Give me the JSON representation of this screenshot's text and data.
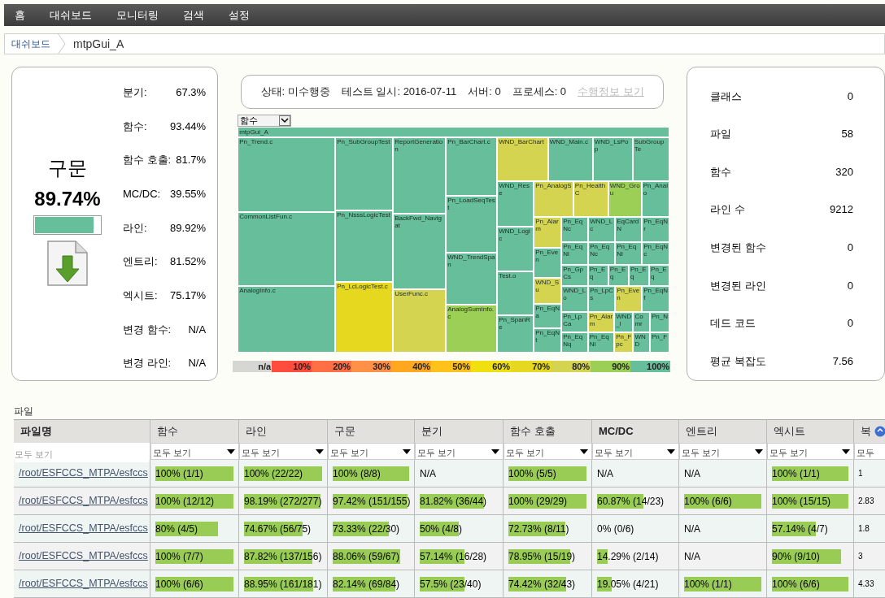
{
  "nav": [
    {
      "label": "홈"
    },
    {
      "label": "대쉬보드"
    },
    {
      "label": "모니터링"
    },
    {
      "label": "검색"
    },
    {
      "label": "설정"
    }
  ],
  "breadcrumb": [
    {
      "label": "대쉬보드"
    },
    {
      "label": "mtpGui_A"
    }
  ],
  "summary": {
    "title": "구문",
    "value": "89.74%",
    "level": 0.8974,
    "stats": [
      {
        "label": "분기:",
        "value": "67.3%"
      },
      {
        "label": "함수:",
        "value": "93.44%"
      },
      {
        "label": "함수 호출:",
        "value": "81.7%"
      },
      {
        "label": "MC/DC:",
        "value": "39.55%"
      },
      {
        "label": "라인:",
        "value": "89.92%"
      },
      {
        "label": "엔트리:",
        "value": "81.52%"
      },
      {
        "label": "엑시트:",
        "value": "75.17%"
      },
      {
        "label": "변경 함수:",
        "value": "N/A"
      },
      {
        "label": "변경 라인:",
        "value": "N/A"
      }
    ]
  },
  "status": {
    "items": [
      "상태: 미수행중",
      "테스트 일시: 2016-07-11",
      "서버: 0",
      "프로세스: 0"
    ],
    "link": "수행정보 보기"
  },
  "treemap": {
    "metric": "함수",
    "root": "mtpGui_A",
    "cells": [
      {
        "label": "Pn_Trend.c",
        "color": "#66bf9a"
      },
      {
        "label": "CommonListFun.c",
        "color": "#66bf9a"
      },
      {
        "label": "AnalogInfo.c",
        "color": "#66bf9a"
      },
      {
        "label": "Pn_SubGroupTest",
        "color": "#66bf9a"
      },
      {
        "label": "Pn_NsssLogicTest",
        "color": "#66bf9a"
      },
      {
        "label": "Pn_LcLogicTest.c",
        "color": "#e6d81f"
      },
      {
        "label": "ReportGeneration",
        "color": "#66bf9a"
      },
      {
        "label": "BackFwd_Navigat",
        "color": "#66bf9a"
      },
      {
        "label": "UserFunc.c",
        "color": "#d4d450"
      },
      {
        "label": "Pn_BarChart.c",
        "color": "#66bf9a"
      },
      {
        "label": "Pn_LoadSeqTest",
        "color": "#66bf9a"
      },
      {
        "label": "WND_TrendSpan",
        "color": "#66bf9a"
      },
      {
        "label": "AnalogSumInfo.c",
        "color": "#9ccf55"
      },
      {
        "label": "WND_BarChart",
        "color": "#d4d450"
      },
      {
        "label": "WND_Main.c",
        "color": "#66bf9a"
      },
      {
        "label": "WND_LsPop",
        "color": "#66bf9a"
      },
      {
        "label": "SubGroupTe",
        "color": "#66bf9a"
      },
      {
        "label": "WND_Rese",
        "color": "#66bf9a"
      },
      {
        "label": "WND_Logic",
        "color": "#66bf9a"
      },
      {
        "label": "Test.o",
        "color": "#66bf9a"
      },
      {
        "label": "Pn_SpanRe",
        "color": "#66bf9a"
      },
      {
        "label": "Pn_AnalogS",
        "color": "#d4d450"
      },
      {
        "label": "Pn_HealthC",
        "color": "#d4d450"
      },
      {
        "label": "WND_Grou",
        "color": "#9ccf55"
      },
      {
        "label": "Pn_Analo",
        "color": "#66bf9a"
      },
      {
        "label": "Pn_Alarm",
        "color": "#d4d450"
      },
      {
        "label": "Pn_Even",
        "color": "#66bf9a"
      },
      {
        "label": "WND_Su",
        "color": "#d4d450"
      },
      {
        "label": "Pn_EqNa",
        "color": "#66bf9a"
      },
      {
        "label": "Pn_EqNt",
        "color": "#66bf9a"
      },
      {
        "label": "Pn_EqNc",
        "color": "#66bf9a"
      },
      {
        "label": "WND_Lc",
        "color": "#66bf9a"
      },
      {
        "label": "EqCardN",
        "color": "#66bf9a"
      },
      {
        "label": "Pn_EqNr",
        "color": "#66bf9a"
      },
      {
        "label": "Pn_EqNi",
        "color": "#66bf9a"
      },
      {
        "label": "Pn_EqNc",
        "color": "#66bf9a"
      },
      {
        "label": "Pn_EqNi",
        "color": "#66bf9a"
      },
      {
        "label": "Pn_EqNc",
        "color": "#66bf9a"
      },
      {
        "label": "Pn_GpCs",
        "color": "#66bf9a"
      },
      {
        "label": "Pn_Eq",
        "color": "#66bf9a"
      },
      {
        "label": "Pn_Eq",
        "color": "#66bf9a"
      },
      {
        "label": "Pn_Eq",
        "color": "#66bf9a"
      },
      {
        "label": "Pn_Eq",
        "color": "#66bf9a"
      },
      {
        "label": "WND_Lo",
        "color": "#66bf9a"
      },
      {
        "label": "Pn_LpCs",
        "color": "#66bf9a"
      },
      {
        "label": "Pn_Even",
        "color": "#d4d450"
      },
      {
        "label": "Pn_EqNf",
        "color": "#66bf9a"
      },
      {
        "label": "Pn_LpCa",
        "color": "#66bf9a"
      },
      {
        "label": "Pn_Alarm",
        "color": "#d4d450"
      },
      {
        "label": "WND_l",
        "color": "#66bf9a"
      },
      {
        "label": "Comr",
        "color": "#66bf9a"
      },
      {
        "label": "Pn_N",
        "color": "#66bf9a"
      },
      {
        "label": "Pn_EqNq",
        "color": "#66bf9a"
      },
      {
        "label": "Pn_EqNi",
        "color": "#66bf9a"
      },
      {
        "label": "Pn_Fpc",
        "color": "#d4d450"
      },
      {
        "label": "WND",
        "color": "#66bf9a"
      },
      {
        "label": "Pn_F",
        "color": "#66bf9a"
      }
    ],
    "legend": [
      {
        "label": "n/a",
        "color": "#d6d6d2"
      },
      {
        "label": "10%",
        "color": "#ff4d3d"
      },
      {
        "label": "20%",
        "color": "#ff6e45"
      },
      {
        "label": "30%",
        "color": "#ff9048"
      },
      {
        "label": "40%",
        "color": "#ffa81f"
      },
      {
        "label": "50%",
        "color": "#ffc21a"
      },
      {
        "label": "60%",
        "color": "#f0e010"
      },
      {
        "label": "70%",
        "color": "#e6d81f"
      },
      {
        "label": "80%",
        "color": "#d4d450"
      },
      {
        "label": "90%",
        "color": "#9ccf55"
      },
      {
        "label": "100%",
        "color": "#66bf9a"
      }
    ]
  },
  "counts": [
    {
      "label": "클래스",
      "value": "0"
    },
    {
      "label": "파일",
      "value": "58"
    },
    {
      "label": "함수",
      "value": "320"
    },
    {
      "label": "라인 수",
      "value": "9212"
    },
    {
      "label": "변경된 함수",
      "value": "0"
    },
    {
      "label": "변경된 라인",
      "value": "0"
    },
    {
      "label": "데드 코드",
      "value": "0"
    },
    {
      "label": "평균 복잡도",
      "value": "7.56"
    }
  ],
  "files": {
    "title": "파일",
    "columns": [
      {
        "label": "파일명",
        "bold": true,
        "placeholder": "모두 보기"
      },
      {
        "label": "함수",
        "bold": false,
        "filter": "모두 보기"
      },
      {
        "label": "라인",
        "bold": false,
        "filter": "모두 보기"
      },
      {
        "label": "구문",
        "bold": false,
        "filter": "모두 보기"
      },
      {
        "label": "분기",
        "bold": false,
        "filter": "모두 보기"
      },
      {
        "label": "함수 호출",
        "bold": false,
        "filter": "모두 보기"
      },
      {
        "label": "MC/DC",
        "bold": true,
        "filter": "모두 보기"
      },
      {
        "label": "엔트리",
        "bold": false,
        "filter": "모두 보기"
      },
      {
        "label": "엑시트",
        "bold": false,
        "filter": "모두 보기"
      },
      {
        "label": "복",
        "bold": false,
        "filter": "모두"
      }
    ],
    "rows": [
      {
        "cells": [
          {
            "kind": "link",
            "text": "/root/ESFCCS_MTPA/esfccs"
          },
          {
            "kind": "bar",
            "text": "100% (1/1)",
            "level": 1
          },
          {
            "kind": "bar",
            "text": "100% (22/22)",
            "level": 1
          },
          {
            "kind": "bar",
            "text": "100% (8/8)",
            "level": 1
          },
          {
            "kind": "plain",
            "text": "N/A"
          },
          {
            "kind": "bar",
            "text": "100% (5/5)",
            "level": 1
          },
          {
            "kind": "plain",
            "text": "N/A"
          },
          {
            "kind": "plain",
            "text": "N/A"
          },
          {
            "kind": "bar",
            "text": "100% (1/1)",
            "level": 1
          },
          {
            "kind": "small",
            "text": "1"
          }
        ]
      },
      {
        "cells": [
          {
            "kind": "link",
            "text": "/root/ESFCCS_MTPA/esfccs"
          },
          {
            "kind": "bar",
            "text": "100% (12/12)",
            "level": 1
          },
          {
            "kind": "bar",
            "text": "98.19% (272/277)",
            "level": 0.9819
          },
          {
            "kind": "bar",
            "text": "97.42% (151/155)",
            "level": 0.9742
          },
          {
            "kind": "bar",
            "text": "81.82% (36/44)",
            "level": 0.8182
          },
          {
            "kind": "bar",
            "text": "100% (29/29)",
            "level": 1
          },
          {
            "kind": "bar",
            "text": "60.87% (14/23)",
            "level": 0.6087
          },
          {
            "kind": "bar",
            "text": "100% (6/6)",
            "level": 1
          },
          {
            "kind": "bar",
            "text": "100% (15/15)",
            "level": 1
          },
          {
            "kind": "small",
            "text": "2.83"
          }
        ]
      },
      {
        "cells": [
          {
            "kind": "link",
            "text": "/root/ESFCCS_MTPA/esfccs"
          },
          {
            "kind": "bar",
            "text": "80% (4/5)",
            "level": 0.8
          },
          {
            "kind": "bar",
            "text": "74.67% (56/75)",
            "level": 0.7467
          },
          {
            "kind": "bar",
            "text": "73.33% (22/30)",
            "level": 0.7333
          },
          {
            "kind": "bar",
            "text": "50% (4/8)",
            "level": 0.5
          },
          {
            "kind": "bar",
            "text": "72.73% (8/11)",
            "level": 0.7273
          },
          {
            "kind": "plain",
            "text": "0% (0/6)"
          },
          {
            "kind": "plain",
            "text": "N/A"
          },
          {
            "kind": "bar",
            "text": "57.14% (4/7)",
            "level": 0.5714
          },
          {
            "kind": "small",
            "text": "1.8"
          }
        ]
      },
      {
        "cells": [
          {
            "kind": "link",
            "text": "/root/ESFCCS_MTPA/esfccs"
          },
          {
            "kind": "bar",
            "text": "100% (7/7)",
            "level": 1
          },
          {
            "kind": "bar",
            "text": "87.82% (137/156)",
            "level": 0.8782
          },
          {
            "kind": "bar",
            "text": "88.06% (59/67)",
            "level": 0.8806
          },
          {
            "kind": "bar",
            "text": "57.14% (16/28)",
            "level": 0.5714
          },
          {
            "kind": "bar",
            "text": "78.95% (15/19)",
            "level": 0.7895
          },
          {
            "kind": "bar",
            "text": "14.29% (2/14)",
            "level": 0.1429
          },
          {
            "kind": "plain",
            "text": "N/A"
          },
          {
            "kind": "bar",
            "text": "90% (9/10)",
            "level": 0.9
          },
          {
            "kind": "small",
            "text": "3"
          }
        ]
      },
      {
        "cells": [
          {
            "kind": "link",
            "text": "/root/ESFCCS_MTPA/esfccs"
          },
          {
            "kind": "bar",
            "text": "100% (6/6)",
            "level": 1
          },
          {
            "kind": "bar",
            "text": "88.95% (161/181)",
            "level": 0.8895
          },
          {
            "kind": "bar",
            "text": "82.14% (69/84)",
            "level": 0.8214
          },
          {
            "kind": "bar",
            "text": "57.5% (23/40)",
            "level": 0.575
          },
          {
            "kind": "bar",
            "text": "74.42% (32/43)",
            "level": 0.7442
          },
          {
            "kind": "bar",
            "text": "19.05% (4/21)",
            "level": 0.1905
          },
          {
            "kind": "bar",
            "text": "100% (1/1)",
            "level": 1
          },
          {
            "kind": "bar",
            "text": "100% (6/6)",
            "level": 1
          },
          {
            "kind": "small",
            "text": "4.33"
          }
        ]
      }
    ]
  }
}
